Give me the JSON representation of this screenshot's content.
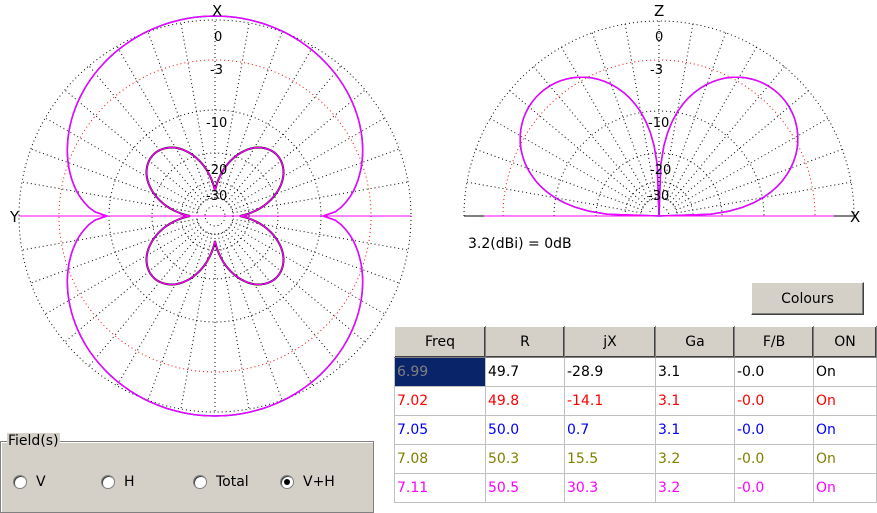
{
  "azimuth_plot": {
    "top_label": "X",
    "left_label": "Y",
    "ring_labels": [
      "0",
      "-3",
      "-10",
      "-20",
      "-30"
    ]
  },
  "elevation_plot": {
    "top_label": "Z",
    "right_label": "X",
    "ring_labels": [
      "0",
      "-3",
      "-10",
      "-20",
      "-30"
    ],
    "gain_reference": "3.2(dBi) = 0dB"
  },
  "colours_button": "Colours",
  "table": {
    "headers": [
      "Freq",
      "R",
      "jX",
      "Ga",
      "F/B",
      "ON"
    ],
    "rows": [
      {
        "color": "#000000",
        "cells": [
          "6.99",
          "49.7",
          "-28.9",
          "3.1",
          "-0.0",
          "On"
        ],
        "selected": true
      },
      {
        "color": "#ff0000",
        "cells": [
          "7.02",
          "49.8",
          "-14.1",
          "3.1",
          "-0.0",
          "On"
        ],
        "selected": false
      },
      {
        "color": "#0000ff",
        "cells": [
          "7.05",
          "50.0",
          "0.7",
          "3.1",
          "-0.0",
          "On"
        ],
        "selected": false
      },
      {
        "color": "#808000",
        "cells": [
          "7.08",
          "50.3",
          "15.5",
          "3.2",
          "-0.0",
          "On"
        ],
        "selected": false
      },
      {
        "color": "#ff00ff",
        "cells": [
          "7.11",
          "50.5",
          "30.3",
          "3.2",
          "-0.0",
          "On"
        ],
        "selected": false
      }
    ]
  },
  "fields": {
    "label": "Field(s)",
    "options": [
      {
        "label": "V",
        "checked": false
      },
      {
        "label": "H",
        "checked": false
      },
      {
        "label": "Total",
        "checked": false
      },
      {
        "label": "V+H",
        "checked": true
      }
    ]
  }
}
